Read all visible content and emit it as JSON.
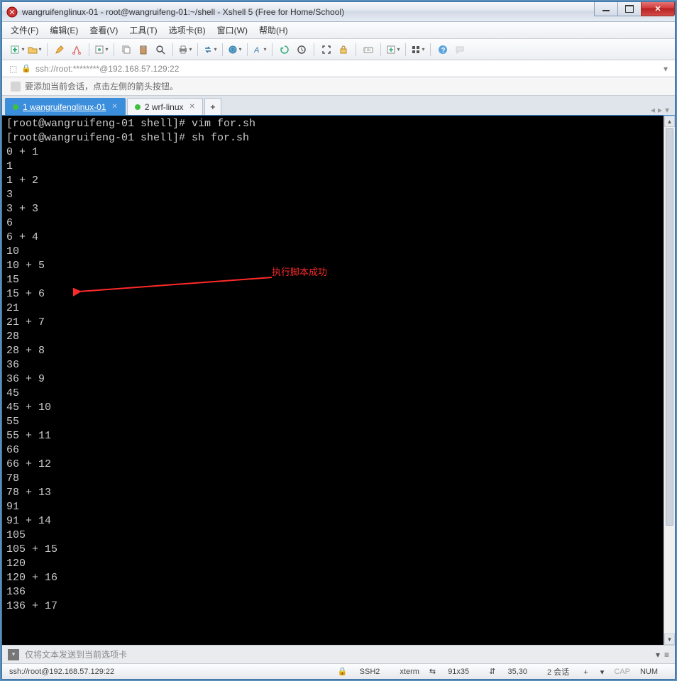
{
  "window": {
    "title": "wangruifenglinux-01 - root@wangruifeng-01:~/shell - Xshell 5 (Free for Home/School)"
  },
  "menu": {
    "file": "文件(F)",
    "edit": "编辑(E)",
    "view": "查看(V)",
    "tools": "工具(T)",
    "tabs": "选项卡(B)",
    "window": "窗口(W)",
    "help": "帮助(H)"
  },
  "address": "ssh://root:********@192.168.57.129:22",
  "hint": "要添加当前会话，点击左侧的箭头按钮。",
  "tabs": [
    {
      "label": "1 wangruifenglinux-01",
      "active": true
    },
    {
      "label": "2 wrf-linux",
      "active": false
    }
  ],
  "terminal_lines": [
    "[root@wangruifeng-01 shell]# vim for.sh",
    "[root@wangruifeng-01 shell]# sh for.sh",
    "0 + 1",
    "1",
    "1 + 2",
    "3",
    "3 + 3",
    "6",
    "6 + 4",
    "10",
    "10 + 5",
    "15",
    "15 + 6",
    "21",
    "21 + 7",
    "28",
    "28 + 8",
    "36",
    "36 + 9",
    "45",
    "45 + 10",
    "55",
    "55 + 11",
    "66",
    "66 + 12",
    "78",
    "78 + 13",
    "91",
    "91 + 14",
    "105",
    "105 + 15",
    "120",
    "120 + 16",
    "136",
    "136 + 17"
  ],
  "annotation": "执行脚本成功",
  "inputbar_placeholder": "仅将文本发送到当前选项卡",
  "status": {
    "conn": "ssh://root@192.168.57.129:22",
    "proto": "SSH2",
    "emul": "xterm",
    "size": "91x35",
    "cursor": "35,30",
    "sessions": "2 会话",
    "cap": "CAP",
    "num": "NUM"
  },
  "toolbar_icons": [
    "new-session-icon",
    "open-icon",
    "pen-icon",
    "cut-icon",
    "settings-icon",
    "copy-icon",
    "paste-icon",
    "find-icon",
    "print-icon",
    "transfer-icon",
    "globe-icon",
    "font-icon",
    "refresh-icon",
    "sync-icon",
    "fullscreen-icon",
    "lock-icon",
    "keyboard-icon",
    "add-box-icon",
    "layout-icon",
    "help-icon",
    "chat-icon"
  ],
  "addrbar_icons": [
    "dropdown-icon",
    "lock-small-icon"
  ],
  "icons": {
    "lock_small": "🔒",
    "overflow": "▾",
    "size_prefix": "⇆",
    "cursor_prefix": "⇵",
    "sessions_prefix": "+",
    "ssh_prefix": "🔒"
  }
}
